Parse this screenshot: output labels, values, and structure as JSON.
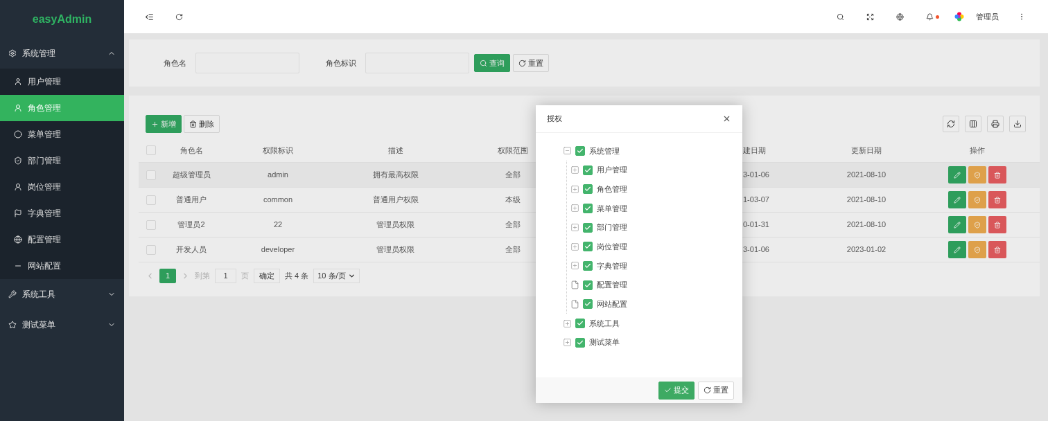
{
  "sidebar": {
    "logo": "easyAdmin",
    "groups": [
      {
        "label": "系统管理",
        "expanded": true,
        "items": [
          {
            "label": "用户管理",
            "selected": false
          },
          {
            "label": "角色管理",
            "selected": true
          },
          {
            "label": "菜单管理",
            "selected": false
          },
          {
            "label": "部门管理",
            "selected": false
          },
          {
            "label": "岗位管理",
            "selected": false
          },
          {
            "label": "字典管理",
            "selected": false
          },
          {
            "label": "配置管理",
            "selected": false
          },
          {
            "label": "网站配置",
            "selected": false
          }
        ]
      },
      {
        "label": "系统工具",
        "expanded": false
      },
      {
        "label": "测试菜单",
        "expanded": false
      }
    ]
  },
  "header": {
    "user": "管理员",
    "notification": true
  },
  "search": {
    "fields": [
      {
        "label": "角色名"
      },
      {
        "label": "角色标识"
      }
    ],
    "buttons": [
      {
        "label": "查询",
        "kind": "primary"
      },
      {
        "label": "重置",
        "kind": "default"
      }
    ]
  },
  "toolbar": {
    "buttons": [
      {
        "label": "新增",
        "kind": "primary"
      },
      {
        "label": "删除",
        "kind": "default"
      }
    ]
  },
  "table": {
    "header_checked": false,
    "columns": [
      "角色名",
      "权限标识",
      "描述",
      "权限范围",
      "建日期",
      "更新日期",
      "操作"
    ],
    "rows": [
      {
        "cells": [
          "超级管理员",
          "admin",
          "拥有最高权限",
          "全部",
          "3-01-06",
          "2021-08-10"
        ],
        "checked": false,
        "selected": true
      },
      {
        "cells": [
          "普通用户",
          "common",
          "普通用户权限",
          "本级",
          "1-03-07",
          "2021-08-10"
        ],
        "checked": false,
        "selected": false
      },
      {
        "cells": [
          "管理员2",
          "22",
          "管理员权限",
          "全部",
          "0-01-31",
          "2021-08-10"
        ],
        "checked": false,
        "selected": false
      },
      {
        "cells": [
          "开发人员",
          "developer",
          "管理员权限",
          "全部",
          "3-01-06",
          "2023-01-02"
        ],
        "checked": false,
        "selected": false
      }
    ]
  },
  "pagination": {
    "pages": [
      {
        "label": "1",
        "selected": true
      }
    ],
    "goto_label": "到第",
    "goto_value": "1",
    "page_unit": "页",
    "confirm": "确定",
    "total": "共 4 条",
    "page_size": "10 条/页"
  },
  "modal": {
    "title": "授权",
    "tree": [
      {
        "label": "系统管理",
        "kind": "branch",
        "expanded": true,
        "checked": true,
        "children": [
          {
            "label": "用户管理",
            "kind": "branch",
            "expanded": false,
            "checked": true
          },
          {
            "label": "角色管理",
            "kind": "branch",
            "expanded": false,
            "checked": true
          },
          {
            "label": "菜单管理",
            "kind": "branch",
            "expanded": false,
            "checked": true
          },
          {
            "label": "部门管理",
            "kind": "branch",
            "expanded": false,
            "checked": true
          },
          {
            "label": "岗位管理",
            "kind": "branch",
            "expanded": false,
            "checked": true
          },
          {
            "label": "字典管理",
            "kind": "branch",
            "expanded": false,
            "checked": true
          },
          {
            "label": "配置管理",
            "kind": "leaf",
            "checked": true
          },
          {
            "label": "网站配置",
            "kind": "leaf",
            "checked": true
          }
        ]
      },
      {
        "label": "系统工具",
        "kind": "branch",
        "expanded": false,
        "checked": true
      },
      {
        "label": "测试菜单",
        "kind": "branch",
        "expanded": false,
        "checked": true
      }
    ],
    "buttons": [
      {
        "label": "提交",
        "kind": "primary"
      },
      {
        "label": "重置",
        "kind": "default"
      }
    ]
  }
}
